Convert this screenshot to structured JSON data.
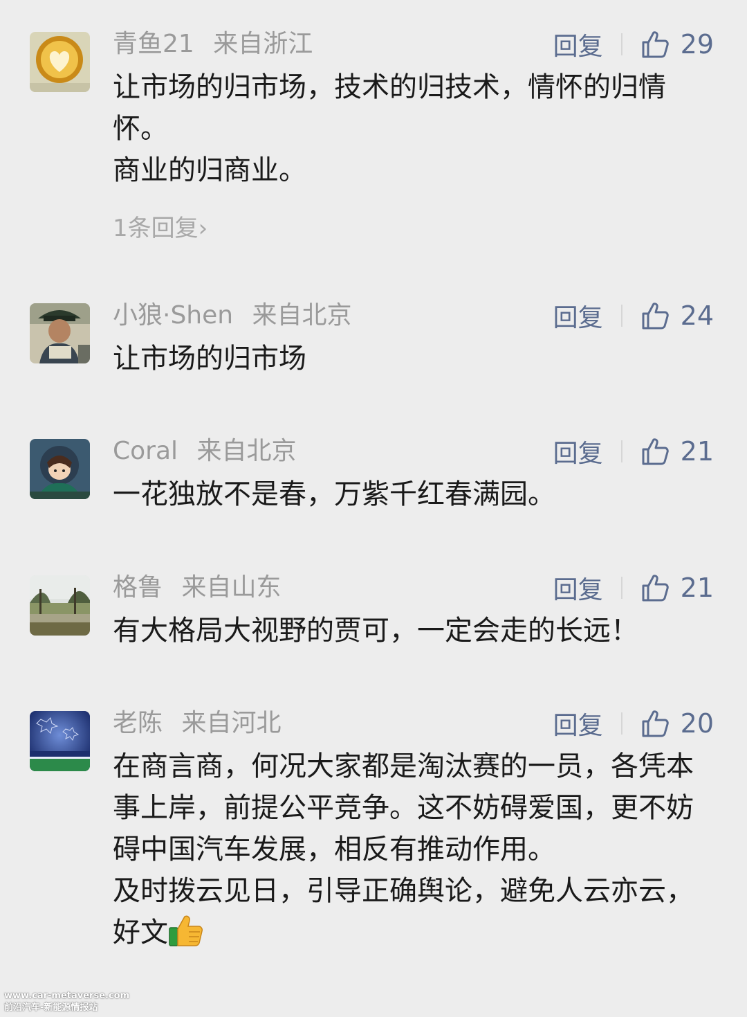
{
  "comments": [
    {
      "username": "青鱼21",
      "location": "来自浙江",
      "reply_label": "回复",
      "likes": "29",
      "avatar_icon": "latte-heart-avatar",
      "paragraphs": [
        "让市场的归市场，技术的归技术，情怀的归情怀。",
        "商业的归商业。"
      ],
      "replies_link": "1条回复"
    },
    {
      "username": "小狼·Shen",
      "location": "来自北京",
      "reply_label": "回复",
      "likes": "24",
      "avatar_icon": "person-hat-avatar",
      "paragraphs": [
        "让市场的归市场"
      ]
    },
    {
      "username": "Coral",
      "location": "来自北京",
      "reply_label": "回复",
      "likes": "21",
      "avatar_icon": "cartoon-character-avatar",
      "paragraphs": [
        "一花独放不是春，万紫千红春满园。"
      ]
    },
    {
      "username": "格鲁",
      "location": "来自山东",
      "reply_label": "回复",
      "likes": "21",
      "avatar_icon": "landscape-avatar",
      "paragraphs": [
        "有大格局大视野的贾可，一定会走的长远！"
      ]
    },
    {
      "username": "老陈",
      "location": "来自河北",
      "reply_label": "回复",
      "likes": "20",
      "avatar_icon": "stadium-avatar",
      "paragraphs": [
        "在商言商，何况大家都是淘汰赛的一员，各凭本事上岸，前提公平竞争。这不妨碍爱国，更不妨碍中国汽车发展，相反有推动作用。",
        "及时拨云见日，引导正确舆论，避免人云亦云，好文"
      ],
      "trailing_emoji": "thumbs-up-emoji"
    }
  ],
  "watermark": {
    "line1": "www.car-metaverse.com",
    "line2": "前沿汽车-新能源情报站"
  },
  "colors": {
    "background": "#ededed",
    "action_blue": "#5b6c8f",
    "meta_gray": "#9a9a9a",
    "text": "#1a1a1a"
  }
}
